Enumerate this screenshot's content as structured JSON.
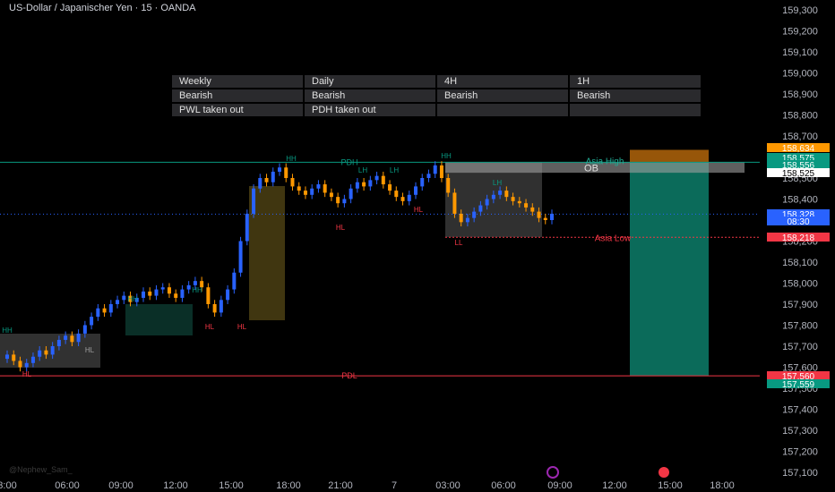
{
  "header": {
    "title": "US-Dollar / Japanischer Yen · 15 · OANDA"
  },
  "bias_table": {
    "rows": [
      [
        "Weekly",
        "Daily",
        "4H",
        "1H"
      ],
      [
        "Bearish",
        "Bearish",
        "Bearish",
        "Bearish"
      ],
      [
        "PWL taken out",
        "PDH taken out",
        "",
        ""
      ]
    ]
  },
  "watermark": "@Nephew_Sam_",
  "chart_data": {
    "type": "candlestick",
    "symbol": "USDJPY",
    "y_axis": {
      "range": [
        157.05,
        159.35
      ],
      "ticks": [
        "159,300",
        "159,200",
        "159,100",
        "159,000",
        "158,900",
        "158,800",
        "158,700",
        "158,600",
        "158,500",
        "158,400",
        "158,300",
        "158,200",
        "158,100",
        "158,000",
        "157,900",
        "157,800",
        "157,700",
        "157,600",
        "157,500",
        "157,400",
        "157,300",
        "157,200",
        "157,100"
      ]
    },
    "x_axis": {
      "ticks": [
        "3:00",
        "06:00",
        "09:00",
        "12:00",
        "15:00",
        "18:00",
        "21:00",
        "7",
        "03:00",
        "06:00",
        "09:00",
        "12:00",
        "15:00",
        "18:00"
      ]
    },
    "candles_close": [
      157.66,
      157.63,
      157.6,
      157.62,
      157.65,
      157.68,
      157.66,
      157.7,
      157.73,
      157.75,
      157.72,
      157.76,
      157.8,
      157.84,
      157.88,
      157.86,
      157.9,
      157.92,
      157.94,
      157.91,
      157.93,
      157.96,
      157.94,
      157.97,
      157.98,
      157.95,
      157.93,
      157.97,
      157.99,
      158.01,
      157.98,
      157.9,
      157.86,
      157.92,
      157.97,
      158.05,
      158.2,
      158.33,
      158.45,
      158.5,
      158.48,
      158.53,
      158.55,
      158.5,
      158.46,
      158.44,
      158.42,
      158.45,
      158.47,
      158.43,
      158.41,
      158.38,
      158.4,
      158.45,
      158.48,
      158.46,
      158.49,
      158.51,
      158.47,
      158.44,
      158.41,
      158.39,
      158.42,
      158.46,
      158.5,
      158.52,
      158.56,
      158.5,
      158.43,
      158.33,
      158.29,
      158.31,
      158.34,
      158.37,
      158.4,
      158.42,
      158.44,
      158.41,
      158.39,
      158.38,
      158.36,
      158.34,
      158.31,
      158.3,
      158.33
    ],
    "levels": [
      {
        "label": "PDH",
        "price": 158.575,
        "color": "#089981"
      },
      {
        "label": "PDL",
        "price": 157.559,
        "color": "#f23645"
      },
      {
        "label": "Asia High",
        "price": 158.575,
        "color": "#22ab94"
      },
      {
        "label": "Asia Low",
        "price": 158.218,
        "color": "#f23645"
      }
    ],
    "annotations": [
      "OB",
      "HH",
      "HL",
      "LH",
      "LL"
    ],
    "price_labels": [
      {
        "text": "158,634",
        "bg": "#ff9800"
      },
      {
        "text": "158,575",
        "bg": "#089981"
      },
      {
        "text": "158,556",
        "bg": "#089981"
      },
      {
        "text": "158,525",
        "bg": "#ffffff"
      },
      {
        "text": "158,328",
        "bg": "#2962ff"
      },
      {
        "text": "08:30",
        "bg": "#2962ff"
      },
      {
        "text": "158,218",
        "bg": "#f23645"
      },
      {
        "text": "157,560",
        "bg": "#f23645"
      },
      {
        "text": "157,559",
        "bg": "#089981"
      }
    ],
    "position": {
      "entry": 158.575,
      "stop": 158.634,
      "target": 157.56
    }
  }
}
